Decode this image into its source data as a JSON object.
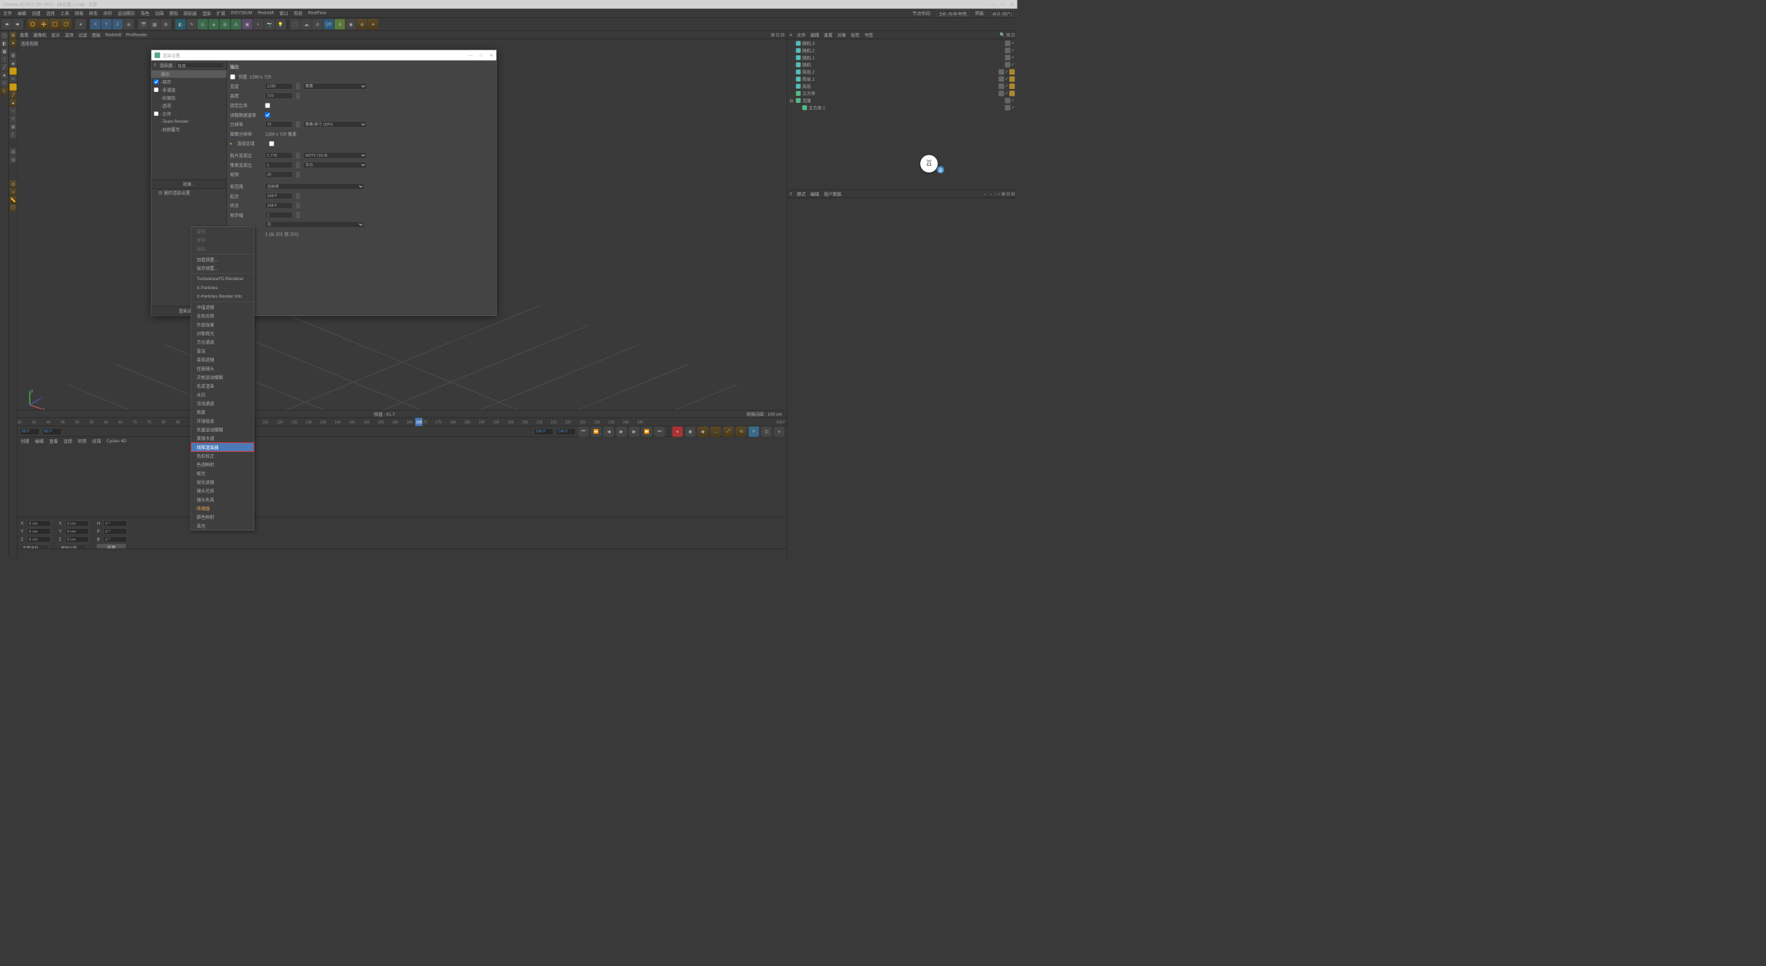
{
  "titlebar": {
    "text": "Cinema 4D R21.207 (RC) - [未标题 2.c4d] - 主要"
  },
  "menu": {
    "items": [
      "文件",
      "编辑",
      "创建",
      "选择",
      "工具",
      "网格",
      "样条",
      "体积",
      "运动图形",
      "角色",
      "动画",
      "模拟",
      "跟踪器",
      "渲染",
      "扩展",
      "INSYDIUM",
      "Redshift",
      "窗口",
      "帮助",
      "RealFlow"
    ],
    "right": {
      "nodespace_label": "节点空间:",
      "nodespace_val": "当前 (标准/物理)",
      "layout_label": "界面:",
      "layout_val": "启动 (用户)"
    }
  },
  "viewtabs": [
    "查看",
    "摄像机",
    "显示",
    "选项",
    "过滤",
    "面板",
    "Redshift",
    "ProRender"
  ],
  "viewport": {
    "label": "透视视图",
    "fps": "帧速 : 61.7",
    "grid": "网格间距 : 100 cm"
  },
  "timeline": {
    "start": 30,
    "end": 245,
    "step": 5,
    "current": 168,
    "endlabel": "168 F"
  },
  "controls": {
    "f1": "60 F",
    "f2": "60 F",
    "f3": "240 F",
    "f4": "240 F"
  },
  "bottommenu": [
    "创建",
    "编辑",
    "查看",
    "选择",
    "材质",
    "纹理",
    "Cycles 4D"
  ],
  "objmenu": [
    "文件",
    "编辑",
    "查看",
    "对象",
    "标签",
    "书签"
  ],
  "objects": [
    {
      "name": "随机.3",
      "icon": "#5bb",
      "indent": 1
    },
    {
      "name": "随机.2",
      "icon": "#5bb",
      "indent": 1
    },
    {
      "name": "随机.1",
      "icon": "#5bb",
      "indent": 1
    },
    {
      "name": "随机",
      "icon": "#5bb",
      "indent": 1
    },
    {
      "name": "简易.2",
      "icon": "#5bb",
      "indent": 1,
      "hastag": true
    },
    {
      "name": "简易.1",
      "icon": "#5bb",
      "indent": 1,
      "hastag": true
    },
    {
      "name": "简易",
      "icon": "#5bb",
      "indent": 1,
      "hastag": true
    },
    {
      "name": "立方体",
      "icon": "#5b8",
      "indent": 1,
      "hastag": true
    },
    {
      "name": "克隆",
      "icon": "#5b8",
      "indent": 0,
      "expand": true
    },
    {
      "name": "立方体.1",
      "icon": "#5b8",
      "indent": 2
    }
  ],
  "attrmenu": [
    "模式",
    "编辑",
    "用户数据"
  ],
  "coords": {
    "x": "0 cm",
    "y": "0 cm",
    "z": "0 cm",
    "sx": "0 cm",
    "sy": "0 cm",
    "sz": "0 cm",
    "h": "0 °",
    "p": "0 °",
    "b": "0 °",
    "apply": "应用",
    "sel1": "世界坐标",
    "sel2": "缩放比例"
  },
  "dialog": {
    "title": "渲染设置",
    "renderer_label": "渲染器",
    "renderer": "标准",
    "left": [
      "输出",
      "保存",
      "多通道",
      "抗锯齿",
      "选项",
      "立体",
      "Team Render",
      "材质覆写"
    ],
    "effects": "效果...",
    "myrender": "我的渲染设置",
    "rensetting": "渲染设置...",
    "section": "输出",
    "fields": {
      "preset_label": "预置: 1280 x 720",
      "width_label": "宽度",
      "width": "1280",
      "width_unit": "像素",
      "height_label": "高度",
      "height": "720",
      "lockratio_label": "锁定比率",
      "datarate_label": "调整数据速率",
      "res_label": "分辨率",
      "res": "72",
      "res_unit": "像素/英寸 (DPI)",
      "imgres_label": "图像分辨率:",
      "imgres": "1280 x 720 像素",
      "region_label": "渲染区域",
      "filmratio_label": "胶片宽高比",
      "filmratio": "1.778",
      "filmratio_preset": "HDTV (16:9)",
      "pixratio_label": "像素宽高比",
      "pixratio": "1",
      "pixratio_preset": "平方",
      "fps_label": "帧频",
      "fps": "30",
      "range_label": "帧范围",
      "range": "当前帧",
      "start_label": "起点",
      "start": "168 F",
      "end_label": "终点",
      "end": "168 F",
      "step_label": "帧步幅",
      "step": "1",
      "field_label": "",
      "field": "无",
      "frames": "1 (从 201 到 201)"
    }
  },
  "ctx": {
    "items_disabled": [
      "复制",
      "复制",
      "粘贴"
    ],
    "items1": [
      "加载预置...",
      "保存预置..."
    ],
    "items2": [
      "TurbulenceFD Renderer",
      "X-Particles",
      "X-Particles Render Info"
    ],
    "items3": [
      "中值滤镜",
      "全局光照",
      "外部效果",
      "对象辉光",
      "方位通道",
      "景深",
      "柔和滤镜",
      "柱面镜头",
      "次帧运动模糊",
      "毛发渲染",
      "水印",
      "法线通道",
      "焦散",
      "环境吸收",
      "矢量运动模糊",
      "素描卡通",
      "线框渲染器",
      "色彩校正",
      "色调映射",
      "辉光",
      "锐化滤镜",
      "镜头光斑",
      "镜头失真",
      "降噪器",
      "颜色映射",
      "高光"
    ],
    "highlighted": "线框渲染器",
    "hlorange": "降噪器"
  }
}
